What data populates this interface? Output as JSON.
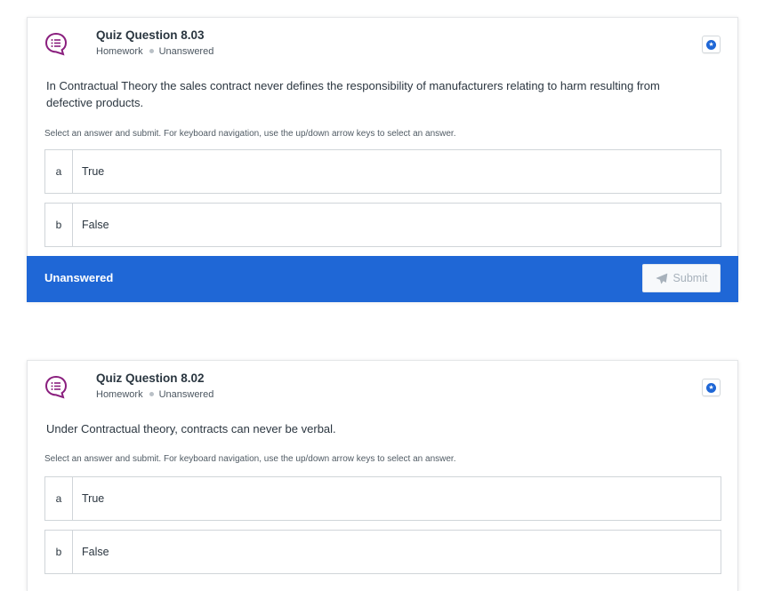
{
  "questions": [
    {
      "title": "Quiz Question 8.03",
      "type": "Homework",
      "state": "Unanswered",
      "text": "In Contractual Theory the sales contract never defines the responsibility of manufacturers relating to harm resulting from defective products.",
      "instructions": "Select an answer and submit. For keyboard navigation, use the up/down arrow keys to select an answer.",
      "options": [
        {
          "letter": "a",
          "label": "True"
        },
        {
          "letter": "b",
          "label": "False"
        }
      ],
      "status": "Unanswered",
      "submit_label": "Submit"
    },
    {
      "title": "Quiz Question 8.02",
      "type": "Homework",
      "state": "Unanswered",
      "text": "Under Contractual theory, contracts can never be verbal.",
      "instructions": "Select an answer and submit. For keyboard navigation, use the up/down arrow keys to select an answer.",
      "options": [
        {
          "letter": "a",
          "label": "True"
        },
        {
          "letter": "b",
          "label": "False"
        }
      ]
    }
  ],
  "icons": {
    "question": "chat-bubble-list-icon",
    "pin": "star-circle-icon",
    "submit": "paper-plane-icon"
  },
  "colors": {
    "accent": "#1f67d6",
    "icon": "#8a1f7e",
    "submit_disabled_text": "#a7b1bb"
  }
}
